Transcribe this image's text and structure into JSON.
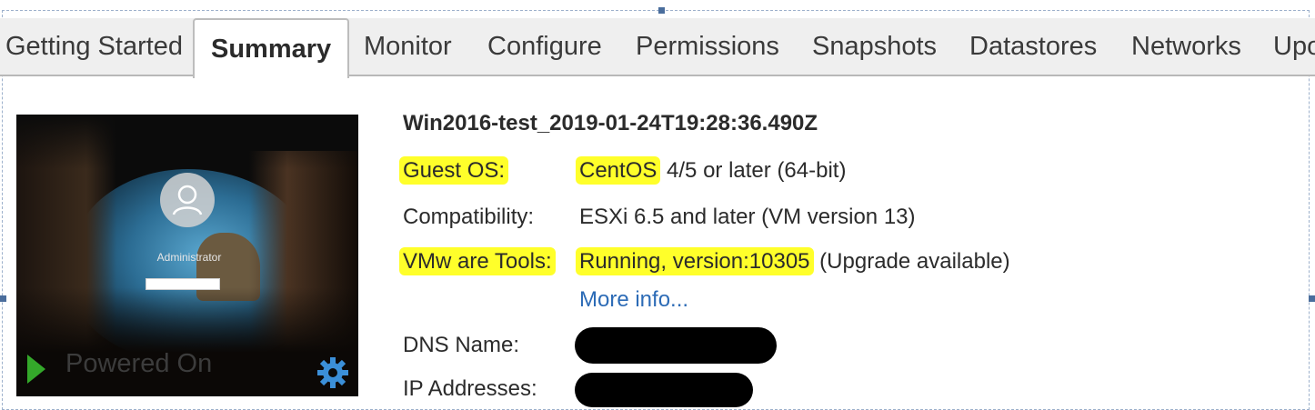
{
  "tabs": [
    {
      "label": "Getting Started"
    },
    {
      "label": "Summary"
    },
    {
      "label": "Monitor"
    },
    {
      "label": "Configure"
    },
    {
      "label": "Permissions"
    },
    {
      "label": "Snapshots"
    },
    {
      "label": "Datastores"
    },
    {
      "label": "Networks"
    },
    {
      "label": "Upo"
    }
  ],
  "active_tab": "Summary",
  "console": {
    "user_label": "Administrator",
    "power_state": "Powered On",
    "icons": [
      "user-icon",
      "play-icon",
      "gear-icon"
    ]
  },
  "vm": {
    "name": "Win2016-test_2019-01-24T19:28:36.490Z",
    "guest_os_label": "Guest OS:",
    "guest_os_highlighted": "CentOS",
    "guest_os_rest": " 4/5 or later (64-bit)",
    "compatibility_label": "Compatibility:",
    "compatibility_value": "ESXi 6.5 and later (VM version 13)",
    "tools_label": "VMw are Tools:",
    "tools_highlighted": "Running, version:10305",
    "tools_rest": " (Upgrade available)",
    "more_info": "More info...",
    "dns_label": "DNS Name:",
    "ip_label": "IP Addresses:"
  },
  "colors": {
    "highlight": "#ffff2a",
    "link": "#2c6bb6",
    "play": "#34a82a",
    "gear": "#3b8fd8"
  }
}
